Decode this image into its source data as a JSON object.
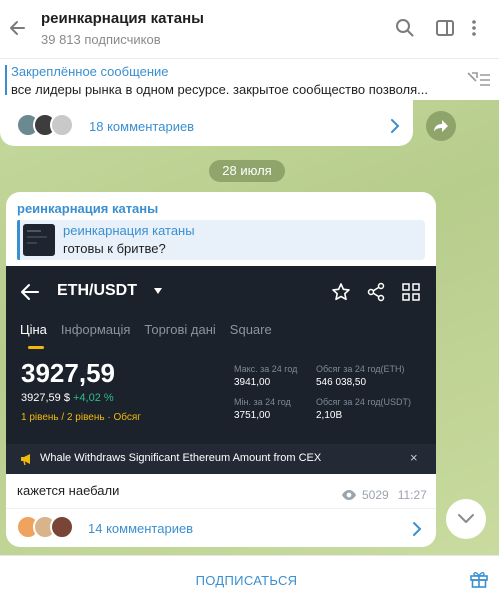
{
  "header": {
    "title": "реинкарнация катаны",
    "subscribers": "39 813 подписчиков"
  },
  "pinned": {
    "title": "Закреплённое сообщение",
    "text": "все лидеры рынка в одном ресурсе.  закрытое сообщество позволя..."
  },
  "top_post": {
    "comments": "18 комментариев"
  },
  "date_pill": "28 июля",
  "post": {
    "author": "реинкарнация катаны",
    "reply": {
      "title": "реинкарнация катаны",
      "text": "готовы к бритве?"
    },
    "screenshot": {
      "pair": "ETH/USDT",
      "tabs": [
        "Ціна",
        "Інформація",
        "Торгові дані",
        "Square"
      ],
      "price": "3927,59",
      "price_usd": "3927,59 $",
      "change": "+4,02 %",
      "levels": "1 рівень / 2 рівень · Обсяг",
      "stats": {
        "high_label": "Макс. за 24 год",
        "high_value": "3941,00",
        "low_label": "Мін. за 24 год",
        "low_value": "3751,00",
        "vol_eth_label": "Обсяг за 24 год(ETH)",
        "vol_eth_value": "546 038,50",
        "vol_usdt_label": "Обсяг за 24 год(USDT)",
        "vol_usdt_value": "2,10B"
      },
      "news": "Whale Withdraws Significant Ethereum Amount from CEX",
      "news_close": "×"
    },
    "text": "кажется наебали",
    "views": "5029",
    "time": "11:27",
    "comments": "14 комментариев"
  },
  "footer": {
    "subscribe": "ПОДПИСАТЬСЯ"
  },
  "colors": {
    "accent": "#3a8fd1",
    "binance_yellow": "#f0b90b",
    "up_green": "#2ebd85"
  }
}
